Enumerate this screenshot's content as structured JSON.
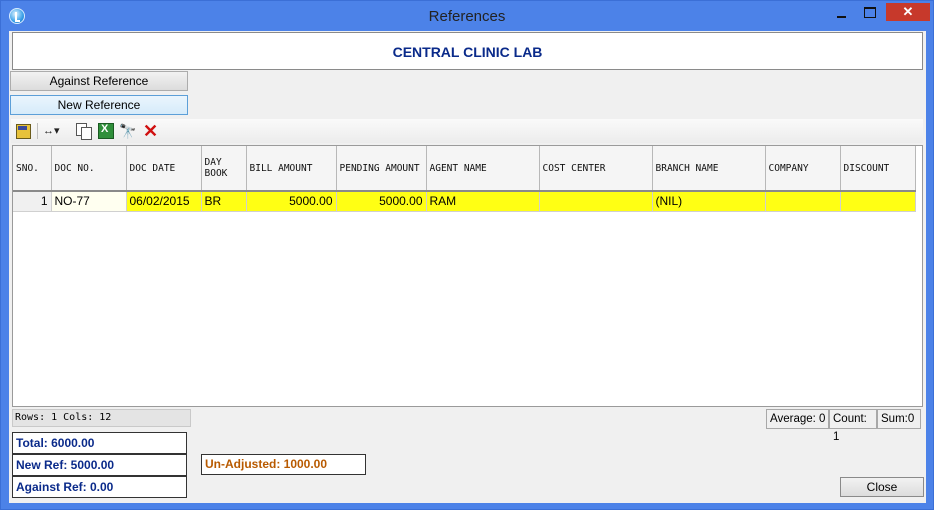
{
  "window": {
    "title": "References",
    "buttons": {
      "minimize": "",
      "maximize": "",
      "close": "✕"
    }
  },
  "header": {
    "title": "CENTRAL CLINIC LAB"
  },
  "mode_buttons": {
    "against": "Against Reference",
    "new": "New Reference"
  },
  "toolbar": {
    "icons": [
      "database-icon",
      "column-resize-icon",
      "copy-icon",
      "excel-export-icon",
      "binoculars-find-icon",
      "delete-x-icon"
    ],
    "cols_glyph": "↔▾",
    "find_glyph": "🔭",
    "delete_glyph": "✕"
  },
  "grid": {
    "headers": [
      "SNO.",
      "DOC NO.",
      "DOC DATE",
      "DAY BOOK",
      "BILL AMOUNT",
      "PENDING AMOUNT",
      "AGENT NAME",
      "COST CENTER",
      "BRANCH NAME",
      "COMPANY",
      "DISCOUNT"
    ],
    "rows": [
      {
        "sno": "1",
        "doc_no": "NO-77",
        "doc_date": "06/02/2015",
        "day_book": "BR",
        "bill_amount": "5000.00",
        "pending_amount": "5000.00",
        "agent_name": "RAM",
        "cost_center": "",
        "branch_name": "(NIL)",
        "company": "",
        "discount": ""
      }
    ],
    "row_highlight_color": "#ffff14"
  },
  "status": {
    "rows_cols": "Rows: 1  Cols: 12",
    "average": "Average: 0",
    "count": "Count: 1",
    "sum": "Sum:0"
  },
  "summary": {
    "total": "Total: 6000.00",
    "new_ref": "New Ref: 5000.00",
    "against_ref": "Against Ref: 0.00",
    "unadjusted": "Un-Adjusted: 1000.00"
  },
  "actions": {
    "close": "Close"
  },
  "colors": {
    "titlebar": "#4c82e8",
    "header_text": "#0a2a8a",
    "unadjusted_text": "#b85a00",
    "close_button": "#c7392b"
  }
}
